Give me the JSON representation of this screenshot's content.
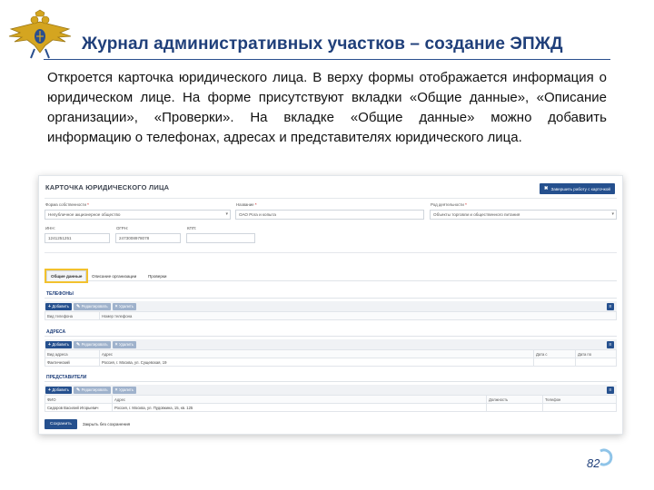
{
  "slide": {
    "title": "Журнал административных участков – создание ЭПЖД",
    "body": "Откроется карточка юридического лица. В верху формы отображается информация о юридическом лице. На форме присутствуют вкладки «Общие данные», «Описание организации», «Проверки». На вкладке «Общие данные» можно добавить информацию о телефонах, адресах и представителях юридического лица.",
    "page_number": "82"
  },
  "card": {
    "title": "КАРТОЧКА ЮРИДИЧЕСКОГО ЛИЦА",
    "close_button": "Завершить работу с карточкой",
    "fields": {
      "ownership": {
        "label": "Форма собственности",
        "value": "Непубличное акционерное общество"
      },
      "name": {
        "label": "Название",
        "value": "ОАО Рога и копыта"
      },
      "activity": {
        "label": "Род деятельности",
        "value": "Объекты торговли и общественного питания"
      },
      "inn": {
        "label": "ИНН:",
        "value": "1241251251"
      },
      "ogrn": {
        "label": "ОГРН:",
        "value": "2473008978078"
      },
      "kpp": {
        "label": "КПП:",
        "value": ""
      }
    },
    "tabs": [
      "Общие данные",
      "Описание организации",
      "Проверки"
    ],
    "toolbar": {
      "add": "Добавить",
      "edit": "Редактировать",
      "delete": "Удалить"
    },
    "phones": {
      "title": "ТЕЛЕФОНЫ",
      "columns": [
        "Вид телефона",
        "Номер телефона"
      ]
    },
    "addresses": {
      "title": "АДРЕСА",
      "columns": [
        "Вид адреса",
        "Адрес",
        "Дата с",
        "Дата по"
      ],
      "rows": [
        [
          "Фактический",
          "Россия, г. Москва, ул. Сущевская, 19",
          "",
          ""
        ]
      ]
    },
    "representatives": {
      "title": "ПРЕДСТАВИТЕЛИ",
      "columns": [
        "ФИО",
        "Адрес",
        "Должность",
        "Телефон"
      ],
      "rows": [
        [
          "Сидоров Василий Игорьевич",
          "Россия, г. Москва, ул. Пудовкина, 15, кв. 125",
          "",
          ""
        ]
      ]
    },
    "save_button": "Сохранить",
    "close_no_save": "Закрыть без сохранения"
  },
  "colors": {
    "accent": "#25508e",
    "title": "#1f3f7a",
    "tab_highlight": "#f2c12e"
  },
  "icons": [
    "double-headed-eagle-emblem",
    "plus-icon",
    "pencil-icon",
    "trash-icon",
    "menu-icon",
    "close-icon",
    "page-arrow-icon"
  ]
}
